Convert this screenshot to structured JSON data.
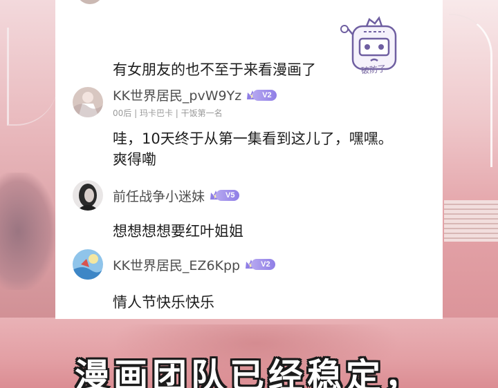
{
  "comments": [
    {
      "text": "有女朋友的也不至于来看漫画了"
    },
    {
      "username": "KK世界居民_pvW9Yz",
      "level": "V2",
      "meta": "00后 | 玛卡巴卡 | 干饭第一名",
      "text_lines": [
        "哇，10天终于从第一集看到这儿了，嘿嘿。",
        "爽得嘞"
      ]
    },
    {
      "username": "前任战争小迷妹",
      "level": "V5",
      "text": "想想想想要红叶姐姐"
    },
    {
      "username": "KK世界居民_EZ6Kpp",
      "level": "V2",
      "text": "情人节快乐快乐"
    }
  ],
  "sticker": {
    "icon": "sad-robot-sticker",
    "label": "破防了"
  },
  "caption": "漫画团队已经稳定，",
  "colors": {
    "badge": "#9a88ea",
    "username": "#4d4d4d",
    "meta": "#9a9a9a",
    "text": "#1e1e1e"
  }
}
